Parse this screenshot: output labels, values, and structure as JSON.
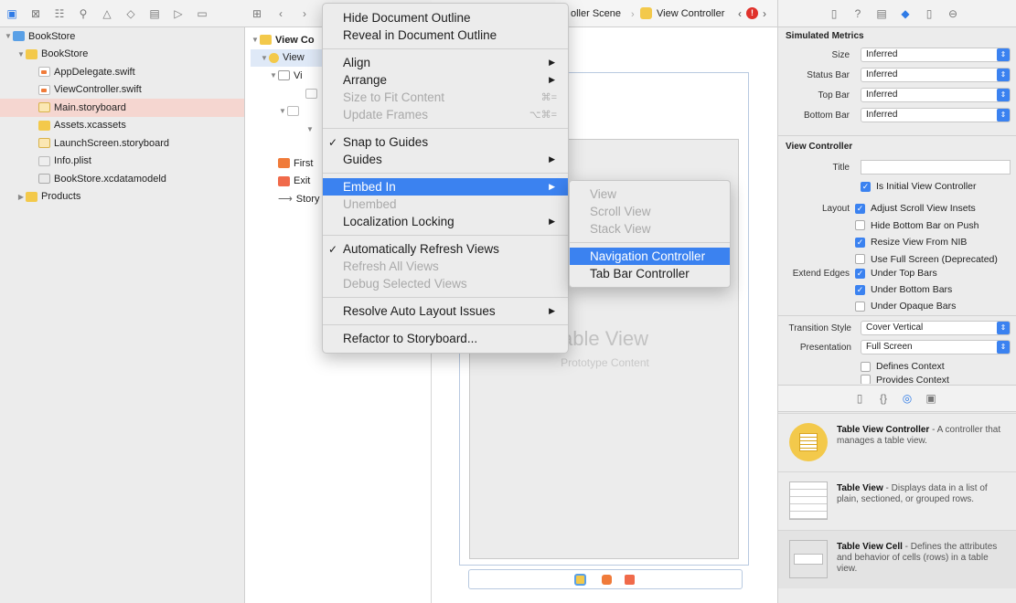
{
  "navigator": {
    "toolbar_icons": [
      "folder-icon",
      "source-control-icon",
      "hierarchy-icon",
      "search-icon",
      "warning-icon",
      "test-icon",
      "debug-icon",
      "breakpoint-icon",
      "report-icon"
    ],
    "items": [
      {
        "label": "BookStore",
        "level": 0,
        "type": "project",
        "expanded": true
      },
      {
        "label": "BookStore",
        "level": 1,
        "type": "folder",
        "expanded": true
      },
      {
        "label": "AppDelegate.swift",
        "level": 2,
        "type": "swift"
      },
      {
        "label": "ViewController.swift",
        "level": 2,
        "type": "swift"
      },
      {
        "label": "Main.storyboard",
        "level": 2,
        "type": "storyboard",
        "selected": true
      },
      {
        "label": "Assets.xcassets",
        "level": 2,
        "type": "folder"
      },
      {
        "label": "LaunchScreen.storyboard",
        "level": 2,
        "type": "storyboard"
      },
      {
        "label": "Info.plist",
        "level": 2,
        "type": "plist"
      },
      {
        "label": "BookStore.xcdatamodeld",
        "level": 2,
        "type": "data"
      },
      {
        "label": "Products",
        "level": 1,
        "type": "folder",
        "expanded": false
      }
    ]
  },
  "outline": {
    "root": "View Co",
    "child1": "View",
    "child2": "Vi",
    "first": "First",
    "exit": "Exit",
    "story": "Story"
  },
  "jumpbar": {
    "scene": "oller Scene",
    "controller": "View Controller"
  },
  "canvas": {
    "table_title": "able View",
    "table_sub": "Prototype Content"
  },
  "inspector": {
    "toolbar_icons": [
      "file-icon",
      "help-icon",
      "identity-icon",
      "attributes-icon",
      "size-icon",
      "connections-icon"
    ],
    "simulated_title": "Simulated Metrics",
    "metrics": [
      {
        "label": "Size",
        "value": "Inferred"
      },
      {
        "label": "Status Bar",
        "value": "Inferred"
      },
      {
        "label": "Top Bar",
        "value": "Inferred"
      },
      {
        "label": "Bottom Bar",
        "value": "Inferred"
      }
    ],
    "vc_title": "View Controller",
    "title_label": "Title",
    "initial_vc": "Is Initial View Controller",
    "layout_label": "Layout",
    "layout_opts": [
      {
        "text": "Adjust Scroll View Insets",
        "on": true
      },
      {
        "text": "Hide Bottom Bar on Push",
        "on": false
      },
      {
        "text": "Resize View From NIB",
        "on": true
      },
      {
        "text": "Use Full Screen (Deprecated)",
        "on": false
      }
    ],
    "extend_label": "Extend Edges",
    "extend_opts": [
      {
        "text": "Under Top Bars",
        "on": true
      },
      {
        "text": "Under Bottom Bars",
        "on": true
      },
      {
        "text": "Under Opaque Bars",
        "on": false
      }
    ],
    "transition_label": "Transition Style",
    "transition_value": "Cover Vertical",
    "presentation_label": "Presentation",
    "presentation_value": "Full Screen",
    "context_opts": [
      "Defines Context",
      "Provides Context"
    ]
  },
  "library": [
    {
      "title": "Table View Controller",
      "desc": " - A controller that manages a table view."
    },
    {
      "title": "Table View",
      "desc": " - Displays data in a list of plain, sectioned, or grouped rows."
    },
    {
      "title": "Table View Cell",
      "desc": " - Defines the attributes and behavior of cells (rows) in a table view."
    }
  ],
  "menu": {
    "items": [
      {
        "label": "Hide Document Outline"
      },
      {
        "label": "Reveal in Document Outline"
      },
      {
        "sep": true
      },
      {
        "label": "Align",
        "sub": true
      },
      {
        "label": "Arrange",
        "sub": true
      },
      {
        "label": "Size to Fit Content",
        "disabled": true,
        "key": "⌘="
      },
      {
        "label": "Update Frames",
        "disabled": true,
        "key": "⌥⌘="
      },
      {
        "sep": true
      },
      {
        "label": "Snap to Guides",
        "checked": true
      },
      {
        "label": "Guides",
        "sub": true
      },
      {
        "sep": true
      },
      {
        "label": "Embed In",
        "sub": true,
        "highlighted": true
      },
      {
        "label": "Unembed",
        "disabled": true
      },
      {
        "label": "Localization Locking",
        "sub": true
      },
      {
        "sep": true
      },
      {
        "label": "Automatically Refresh Views",
        "checked": true
      },
      {
        "label": "Refresh All Views",
        "disabled": true
      },
      {
        "label": "Debug Selected Views",
        "disabled": true
      },
      {
        "sep": true
      },
      {
        "label": "Resolve Auto Layout Issues",
        "sub": true
      },
      {
        "sep": true
      },
      {
        "label": "Refactor to Storyboard..."
      }
    ]
  },
  "submenu": {
    "items": [
      {
        "label": "View",
        "disabled": true
      },
      {
        "label": "Scroll View",
        "disabled": true
      },
      {
        "label": "Stack View",
        "disabled": true
      },
      {
        "sep": true
      },
      {
        "label": "Navigation Controller",
        "highlighted": true
      },
      {
        "label": "Tab Bar Controller"
      }
    ]
  },
  "colors": {
    "accent": "#3b82f0",
    "selection": "#f5d6d0",
    "folder": "#f3c94b"
  }
}
